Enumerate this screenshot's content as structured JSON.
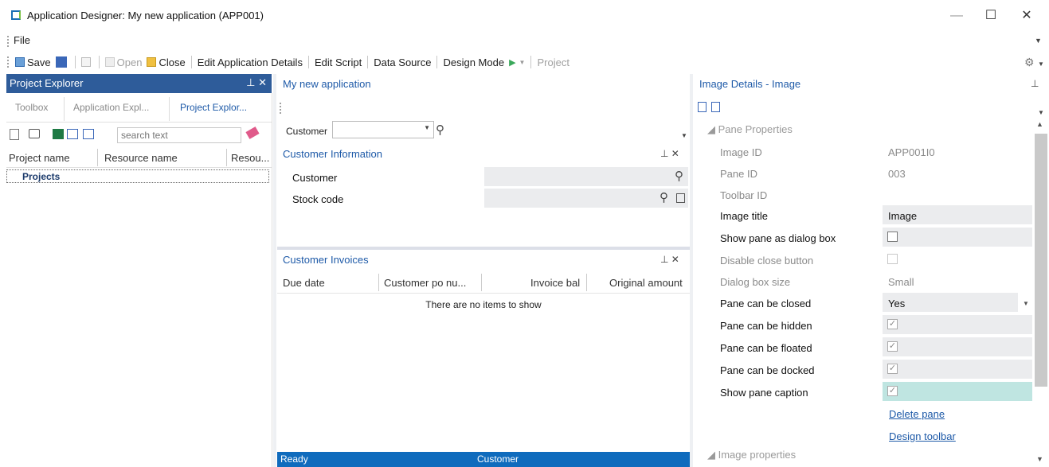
{
  "window": {
    "title": "Application Designer: My new application  (APP001)",
    "minimize": "—",
    "maximize": "☐",
    "close": "✕"
  },
  "menu": {
    "file": "File"
  },
  "toolbar": {
    "save": "Save",
    "open": "Open",
    "close": "Close",
    "edit_app_details": "Edit Application Details",
    "edit_script": "Edit Script",
    "data_source": "Data Source",
    "design_mode": "Design Mode",
    "project": "Project"
  },
  "left": {
    "header": "Project Explorer",
    "header_controls": "⊥ ✕",
    "tabs": [
      "Toolbox",
      "Application Expl...",
      "Project Explor..."
    ],
    "search_placeholder": "search text",
    "columns": [
      "Project name",
      "Resource name",
      "Resou..."
    ],
    "rows": [
      "Projects"
    ]
  },
  "middle": {
    "title": "My new application",
    "customer_label": "Customer",
    "customer_info": {
      "title": "Customer Information",
      "controls": "⊥ ✕",
      "fields": [
        "Customer",
        "Stock code"
      ]
    },
    "invoices": {
      "title": "Customer Invoices",
      "controls": "⊥ ✕",
      "columns": [
        "Due date",
        "Customer po nu...",
        "Invoice bal",
        "Original amount"
      ],
      "empty": "There are no items to show"
    },
    "status": {
      "left": "Ready",
      "center": "Customer"
    }
  },
  "right": {
    "title": "Image Details - Image",
    "pin": "⊥",
    "section1": "◢ Pane Properties",
    "section2": "◢ Image properties",
    "props": [
      {
        "label": "Image ID",
        "value": "APP001I0",
        "enabled": false
      },
      {
        "label": "Pane ID",
        "value": "003",
        "enabled": false
      },
      {
        "label": "Toolbar ID",
        "value": "",
        "enabled": false
      },
      {
        "label": "Image title",
        "value": "Image",
        "enabled": true
      },
      {
        "label": "Show pane as dialog box",
        "checked": false,
        "enabled": true
      },
      {
        "label": "Disable close button",
        "checked": false,
        "enabled": false
      },
      {
        "label": "Dialog box size",
        "value": "Small",
        "enabled": false
      },
      {
        "label": "Pane can be closed",
        "value": "Yes",
        "enabled": true
      },
      {
        "label": "Pane can be hidden",
        "checked": true,
        "enabled": true
      },
      {
        "label": "Pane can be floated",
        "checked": true,
        "enabled": true
      },
      {
        "label": "Pane can be docked",
        "checked": true,
        "enabled": true
      },
      {
        "label": "Show pane caption",
        "checked": true,
        "enabled": true
      }
    ],
    "links": [
      "Delete pane",
      "Design toolbar"
    ]
  }
}
